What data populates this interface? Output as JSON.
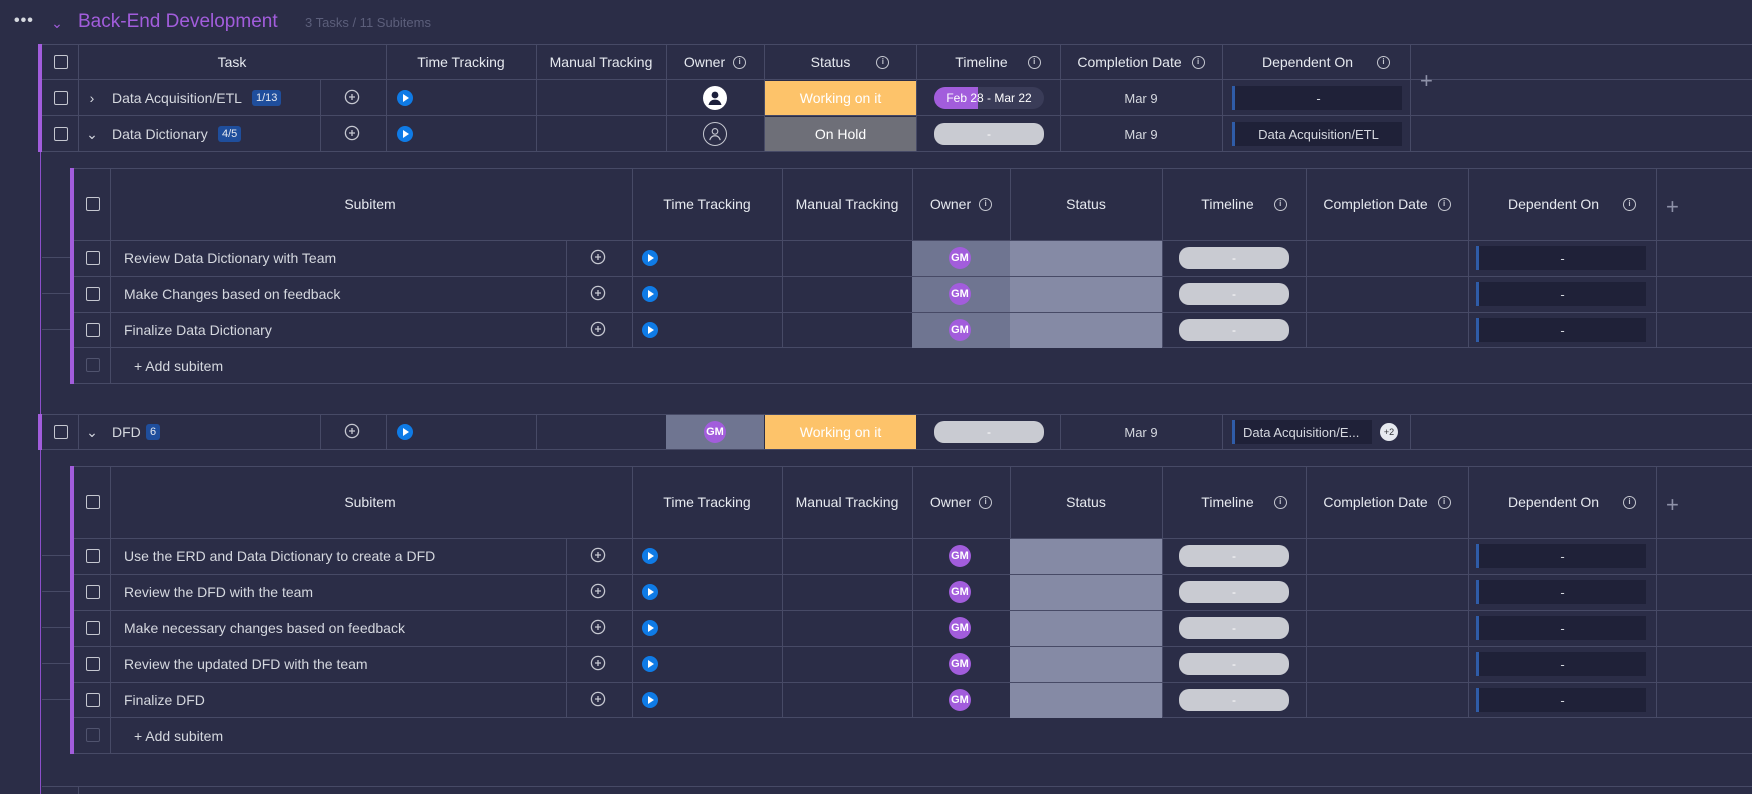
{
  "group": {
    "title": "Back-End Development",
    "count": "3 Tasks / 11 Subitems",
    "columns": {
      "task": "Task",
      "time_tracking": "Time Tracking",
      "manual_tracking": "Manual Tracking",
      "owner": "Owner",
      "status": "Status",
      "timeline": "Timeline",
      "completion_date": "Completion Date",
      "dependent_on": "Dependent On"
    },
    "tasks": [
      {
        "name": "Data Acquisition/ETL",
        "badge": "1/13",
        "status": "Working on it",
        "timeline": "Feb 28 - Mar 22",
        "completion": "Mar 9",
        "dependent": "-"
      },
      {
        "name": "Data Dictionary",
        "badge": "4/5",
        "status": "On Hold",
        "timeline": "-",
        "completion": "Mar 9",
        "dependent": "Data Acquisition/ETL"
      },
      {
        "name": "DFD",
        "badge": "6",
        "owner": "GM",
        "status": "Working on it",
        "timeline": "-",
        "completion": "Mar 9",
        "dependent": "Data Acquisition/E...",
        "dependent_extra": "+2"
      }
    ]
  },
  "subitems": {
    "columns": {
      "subitem": "Subitem",
      "time_tracking": "Time Tracking",
      "manual_tracking": "Manual Tracking",
      "owner": "Owner",
      "status": "Status",
      "timeline": "Timeline",
      "completion_date": "Completion Date",
      "dependent_on": "Dependent On"
    },
    "add_label": "+ Add subitem",
    "dictionary": [
      {
        "name": "Review Data Dictionary with Team",
        "owner": "GM",
        "timeline": "-",
        "dependent": "-"
      },
      {
        "name": "Make Changes based on feedback",
        "owner": "GM",
        "timeline": "-",
        "dependent": "-"
      },
      {
        "name": "Finalize Data Dictionary",
        "owner": "GM",
        "timeline": "-",
        "dependent": "-"
      }
    ],
    "dfd": [
      {
        "name": "Use the ERD and Data Dictionary to create a DFD",
        "owner": "GM",
        "timeline": "-",
        "dependent": "-"
      },
      {
        "name": "Review the DFD with the team",
        "owner": "GM",
        "timeline": "-",
        "dependent": "-"
      },
      {
        "name": "Make necessary changes based on feedback",
        "owner": "GM",
        "timeline": "-",
        "dependent": "-"
      },
      {
        "name": "Review the updated DFD with the team",
        "owner": "GM",
        "timeline": "-",
        "dependent": "-"
      },
      {
        "name": "Finalize DFD",
        "owner": "GM",
        "timeline": "-",
        "dependent": "-"
      }
    ]
  },
  "colors": {
    "group_accent": "#a25ddc",
    "working_on_it": "#fdc36a",
    "on_hold": "#6e6f78",
    "status_empty": "#858aa5",
    "owner_highlight": "#6f7591"
  }
}
